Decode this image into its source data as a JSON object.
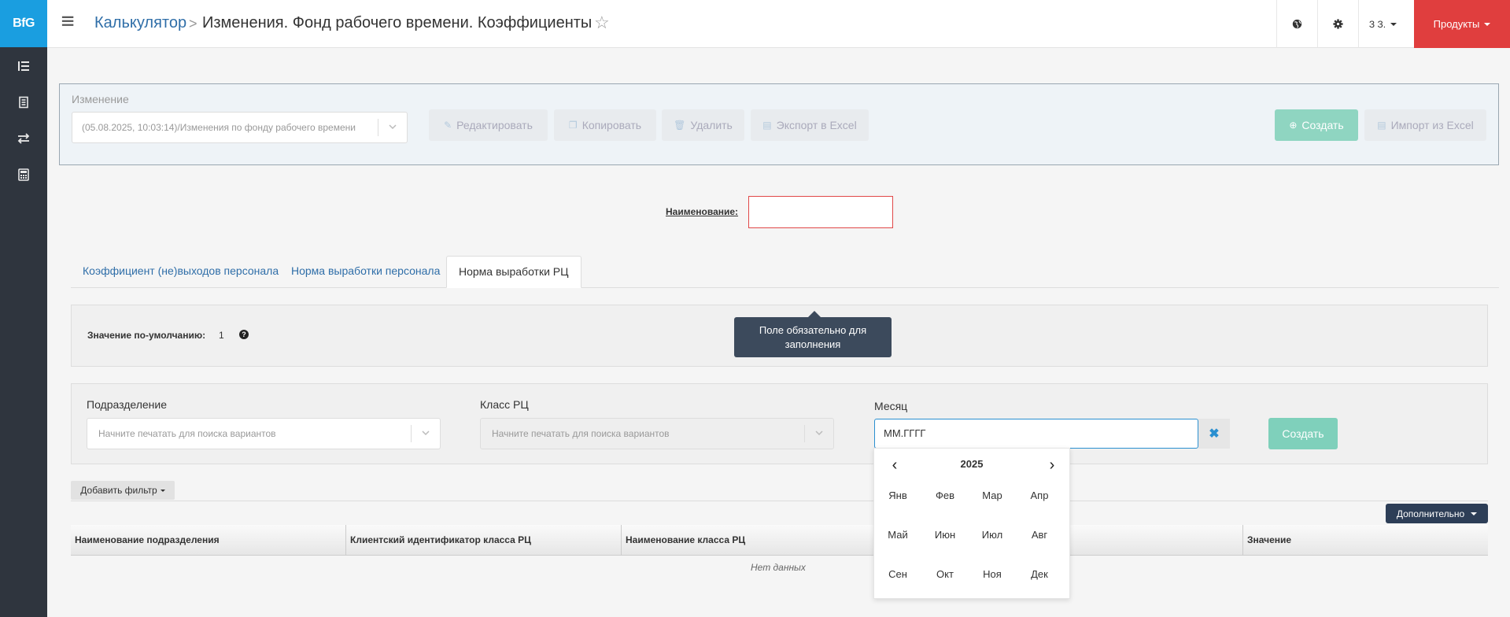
{
  "app": {
    "logo": "BfG"
  },
  "header": {
    "breadcrumb_root": "Калькулятор",
    "breadcrumb_sep": ">",
    "page_title": "Изменения. Фонд рабочего времени. Коэффициенты",
    "user_label": "З З.",
    "products_label": "Продукты"
  },
  "change_panel": {
    "label": "Изменение",
    "selected": "(05.08.2025, 10:03:14)/Изменения по фонду рабочего времени",
    "buttons": {
      "edit": "Редактировать",
      "copy": "Копировать",
      "delete": "Удалить",
      "export": "Экспорт в Excel",
      "create": "Создать",
      "import": "Импорт из Excel"
    }
  },
  "name_field": {
    "label": "Наименование:",
    "value": ""
  },
  "tabs": [
    {
      "label": "Коэффициент (не)выходов персонала",
      "active": false
    },
    {
      "label": "Норма выработки персонала",
      "active": false
    },
    {
      "label": "Норма выработки РЦ",
      "active": true
    }
  ],
  "default_value": {
    "label": "Значение по-умолчанию:",
    "value": "1"
  },
  "tooltip": {
    "text": "Поле обязательно для заполнения"
  },
  "filters": {
    "division_label": "Подразделение",
    "division_placeholder": "Начните печатать для поиска вариантов",
    "rc_class_label": "Класс РЦ",
    "rc_class_placeholder": "Начните печатать для поиска вариантов",
    "month_label": "Месяц",
    "month_value": "ММ.ГГГГ",
    "create_label": "Создать"
  },
  "toolbar": {
    "add_filter": "Добавить фильтр",
    "more": "Дополнительно"
  },
  "table": {
    "columns": [
      "Наименование подразделения",
      "Клиентский идентификатор класса РЦ",
      "Наименование класса РЦ",
      "Значение"
    ],
    "empty_text": "Нет данных"
  },
  "calendar": {
    "prev": "‹",
    "next": "›",
    "year": "2025",
    "months": [
      "Янв",
      "Фев",
      "Мар",
      "Апр",
      "Май",
      "Июн",
      "Июл",
      "Авг",
      "Сен",
      "Окт",
      "Ноя",
      "Дек"
    ]
  },
  "colors": {
    "accent": "#1a9ee0",
    "sidebar": "#2f353e",
    "products": "#e03e3e",
    "create": "#7fd0bb",
    "tooltip": "#3c4a5c"
  }
}
